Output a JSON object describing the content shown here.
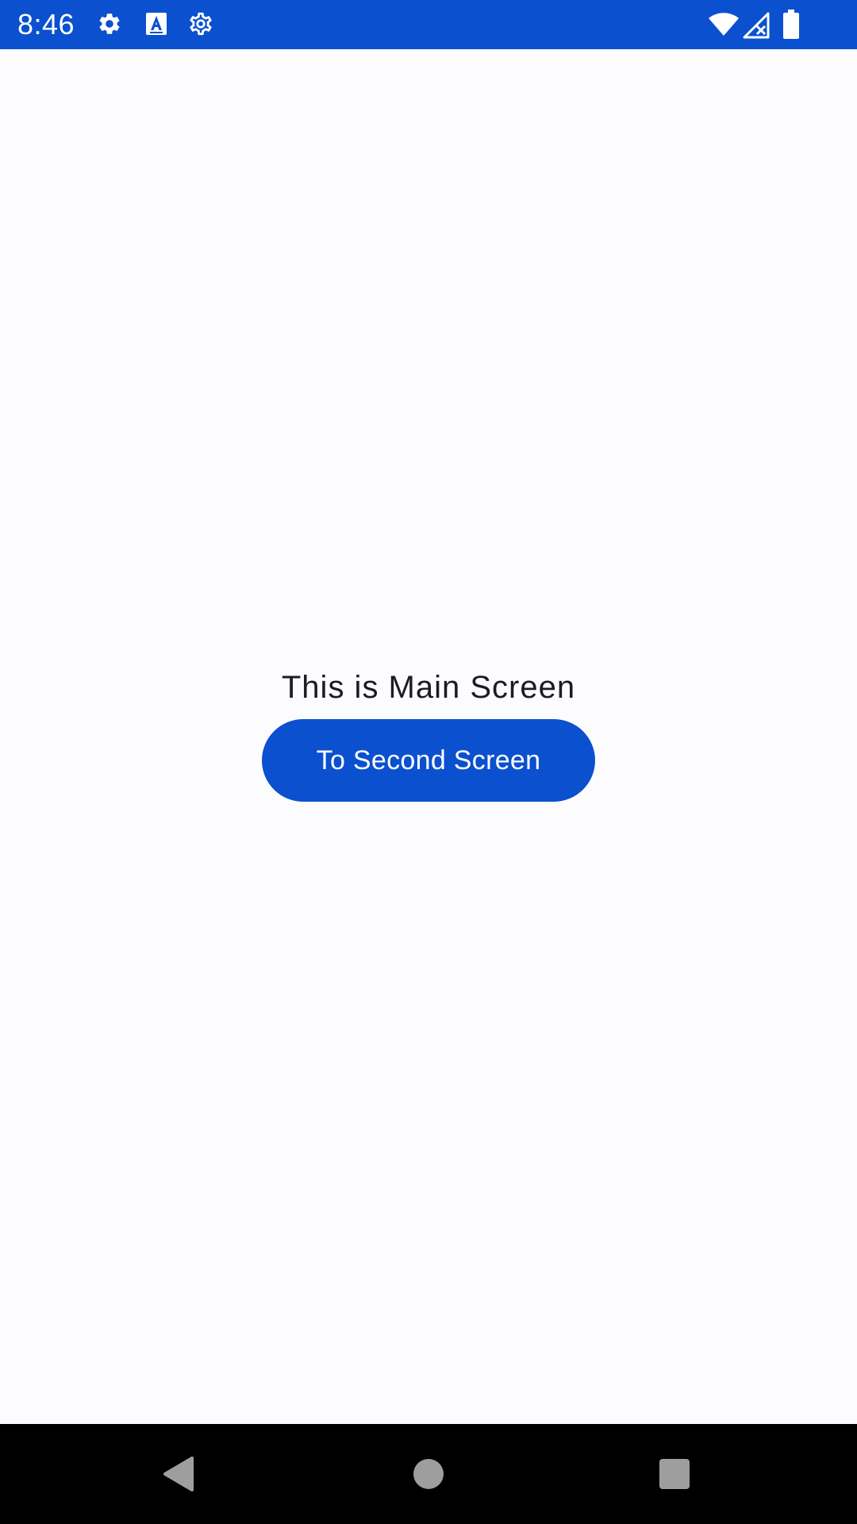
{
  "status_bar": {
    "time": "8:46",
    "background_color": "#0b50cf",
    "left_icons": [
      "settings-gear-icon",
      "a-notification-icon",
      "settings-outline-icon"
    ],
    "right_icons": [
      "wifi-icon",
      "signal-icon",
      "battery-icon"
    ]
  },
  "main": {
    "title": "This is Main Screen",
    "button_label": "To Second Screen",
    "button_color": "#0b50cf"
  },
  "nav_bar": {
    "items": [
      "back-icon",
      "home-icon",
      "recents-icon"
    ]
  }
}
